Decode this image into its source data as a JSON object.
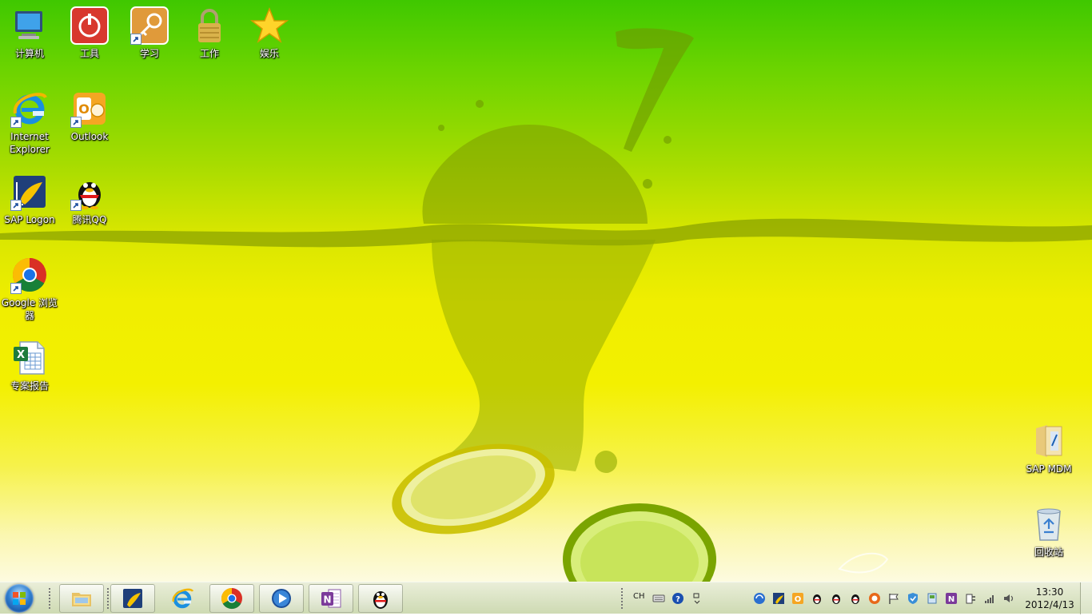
{
  "desktop": {
    "icons": [
      {
        "id": "computer",
        "label": "计算机"
      },
      {
        "id": "tools",
        "label": "工具"
      },
      {
        "id": "study",
        "label": "学习"
      },
      {
        "id": "work",
        "label": "工作"
      },
      {
        "id": "entertainment",
        "label": "娱乐"
      },
      {
        "id": "ie",
        "label": "Internet Explorer"
      },
      {
        "id": "outlook",
        "label": "Outlook"
      },
      {
        "id": "sap-logon",
        "label": "SAP Logon"
      },
      {
        "id": "qq",
        "label": "腾讯QQ"
      },
      {
        "id": "chrome",
        "label": "Google 浏览器"
      },
      {
        "id": "report",
        "label": "专案报告"
      },
      {
        "id": "sap-mdm",
        "label": "SAP MDM"
      },
      {
        "id": "recycle-bin",
        "label": "回收站"
      }
    ]
  },
  "taskbar": {
    "language": "CH",
    "clock": {
      "time": "13:30",
      "date": "2012/4/13"
    }
  },
  "colors": {
    "wallpaper_top": "#3fc800",
    "wallpaper_mid": "#f0ee00",
    "wallpaper_bottom": "#fdfbe0",
    "taskbar": "#d8dfc4"
  }
}
